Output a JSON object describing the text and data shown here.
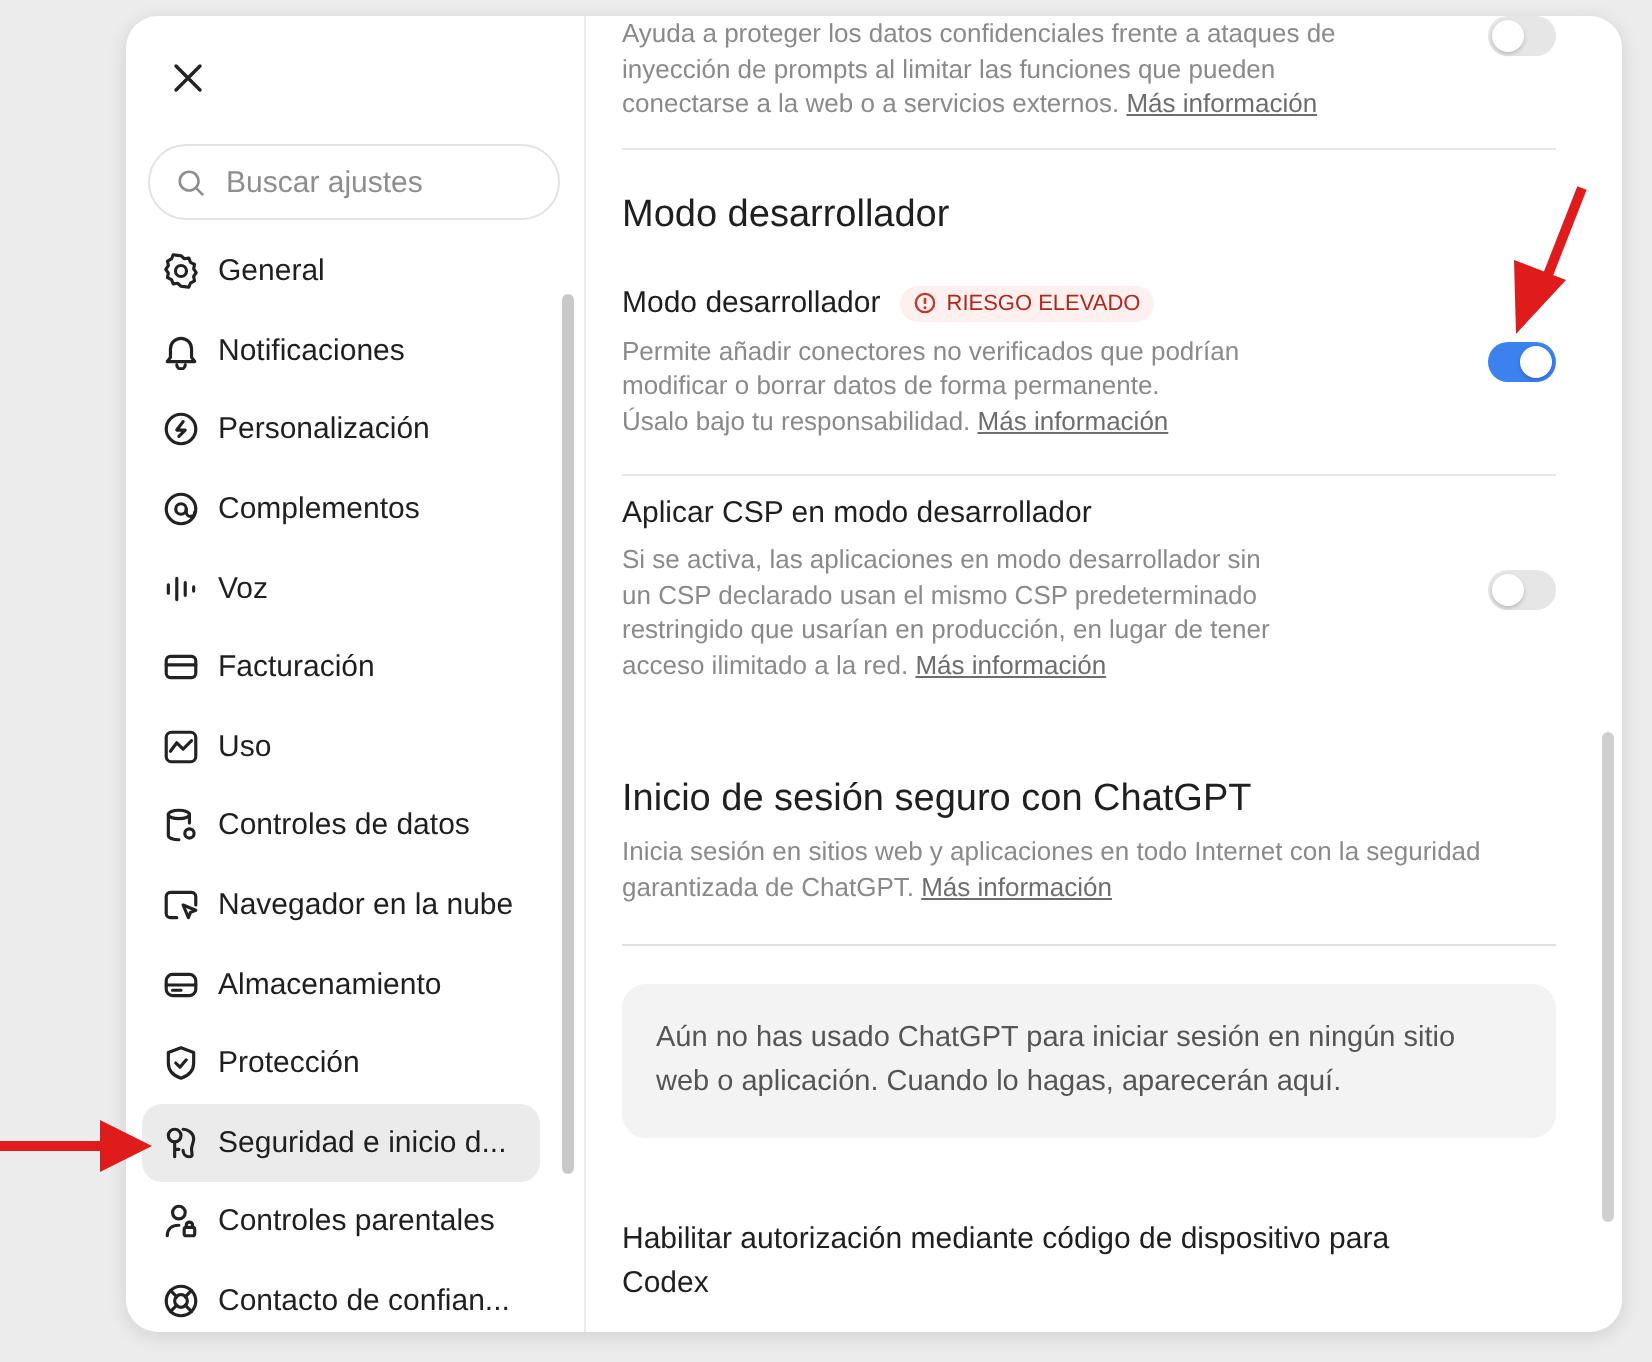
{
  "search": {
    "placeholder": "Buscar ajustes"
  },
  "sidebar": {
    "items": [
      {
        "label": "General",
        "selected": false
      },
      {
        "label": "Notificaciones",
        "selected": false
      },
      {
        "label": "Personalización",
        "selected": false
      },
      {
        "label": "Complementos",
        "selected": false
      },
      {
        "label": "Voz",
        "selected": false
      },
      {
        "label": "Facturación",
        "selected": false
      },
      {
        "label": "Uso",
        "selected": false
      },
      {
        "label": "Controles de datos",
        "selected": false
      },
      {
        "label": "Navegador en la nube",
        "selected": false
      },
      {
        "label": "Almacenamiento",
        "selected": false
      },
      {
        "label": "Protección",
        "selected": false
      },
      {
        "label": "Seguridad e inicio d...",
        "selected": true
      },
      {
        "label": "Controles parentales",
        "selected": false
      },
      {
        "label": "Contacto de confian...",
        "selected": false
      }
    ]
  },
  "content": [
    {
      "kind": "setting",
      "description": "Ayuda a proteger los datos confidenciales frente a ataques de inyección de prompts al limitar las funciones que pueden conectarse a la web o a servicios externos.",
      "link": "Más información",
      "on": false,
      "divider": true
    },
    {
      "kind": "heading",
      "title": "Modo desarrollador"
    },
    {
      "kind": "setting",
      "title": "Modo desarrollador",
      "badge": "RIESGO ELEVADO",
      "description": "Permite añadir conectores no verificados que podrían modificar o borrar datos de forma permanente.\nÚsalo bajo tu responsabilidad.",
      "link": "Más información",
      "on": true,
      "divider": true
    },
    {
      "kind": "setting",
      "title": "Aplicar CSP en modo desarrollador",
      "description": "Si se activa, las aplicaciones en modo desarrollador sin un CSP declarado usan el mismo CSP predeterminado restringido que usarían en producción, en lugar de tener acceso ilimitado a la red.",
      "link": "Más información",
      "on": false,
      "divider": false
    },
    {
      "kind": "heading",
      "title": "Inicio de sesión seguro con ChatGPT",
      "description": "Inicia sesión en sitios web y aplicaciones en todo Internet con la seguridad garantizada de ChatGPT.",
      "link": "Más información"
    },
    {
      "kind": "notice",
      "text": "Aún no has usado ChatGPT para iniciar sesión en ningún sitio web o aplicación. Cuando lo hagas, aparecerán aquí."
    },
    {
      "kind": "title",
      "title": "Habilitar autorización mediante código de dispositivo para Codex"
    }
  ]
}
